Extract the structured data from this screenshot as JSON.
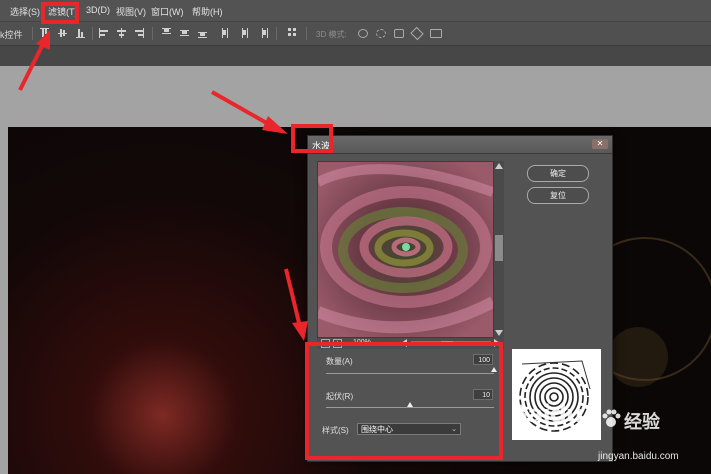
{
  "menubar": {
    "items": [
      "选择(S)",
      "滤镜(T)",
      "3D(D)",
      "视图(V)",
      "窗口(W)",
      "帮助(H)"
    ]
  },
  "optionsbar": {
    "label": "k控件",
    "mode3d_label": "3D 模式:"
  },
  "dialog": {
    "title": "水波",
    "ok_label": "确定",
    "reset_label": "复位",
    "zoom_level": "100%",
    "amount": {
      "label": "数量(A)",
      "value": "100",
      "fraction": 1.0
    },
    "ridges": {
      "label": "起伏(R)",
      "value": "10",
      "fraction": 0.5
    },
    "style": {
      "label": "样式(S)",
      "selected": "围绕中心"
    }
  },
  "watermark": {
    "brand": "Baidu",
    "suffix": "经验",
    "url": "jingyan.baidu.com"
  },
  "colors": {
    "annotation_red": "#e8262b",
    "dialog_bg": "#535353",
    "menubar_bg": "#535353"
  }
}
